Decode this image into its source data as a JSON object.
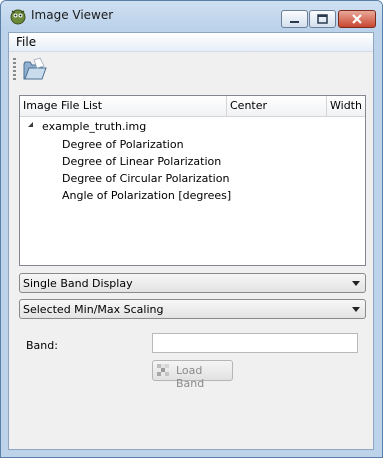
{
  "window": {
    "title": "Image Viewer"
  },
  "menubar": {
    "file_label": "File"
  },
  "toolbar": {
    "open_icon": "folder-open-icon"
  },
  "tree": {
    "columns": [
      "Image File List",
      "Center",
      "Width"
    ],
    "root": "example_truth.img",
    "children": [
      "Degree of Polarization",
      "Degree of Linear Polarization",
      "Degree of Circular Polarization",
      "Angle of Polarization [degrees]"
    ]
  },
  "display_mode": {
    "selected": "Single Band Display"
  },
  "scaling": {
    "selected": "Selected Min/Max Scaling"
  },
  "band": {
    "label": "Band:",
    "value": ""
  },
  "load_button": {
    "label": "Load Band",
    "enabled": false
  },
  "colors": {
    "title_bar": "#bcd3ea",
    "close": "#c8462f",
    "client": "#f0f0f0"
  }
}
